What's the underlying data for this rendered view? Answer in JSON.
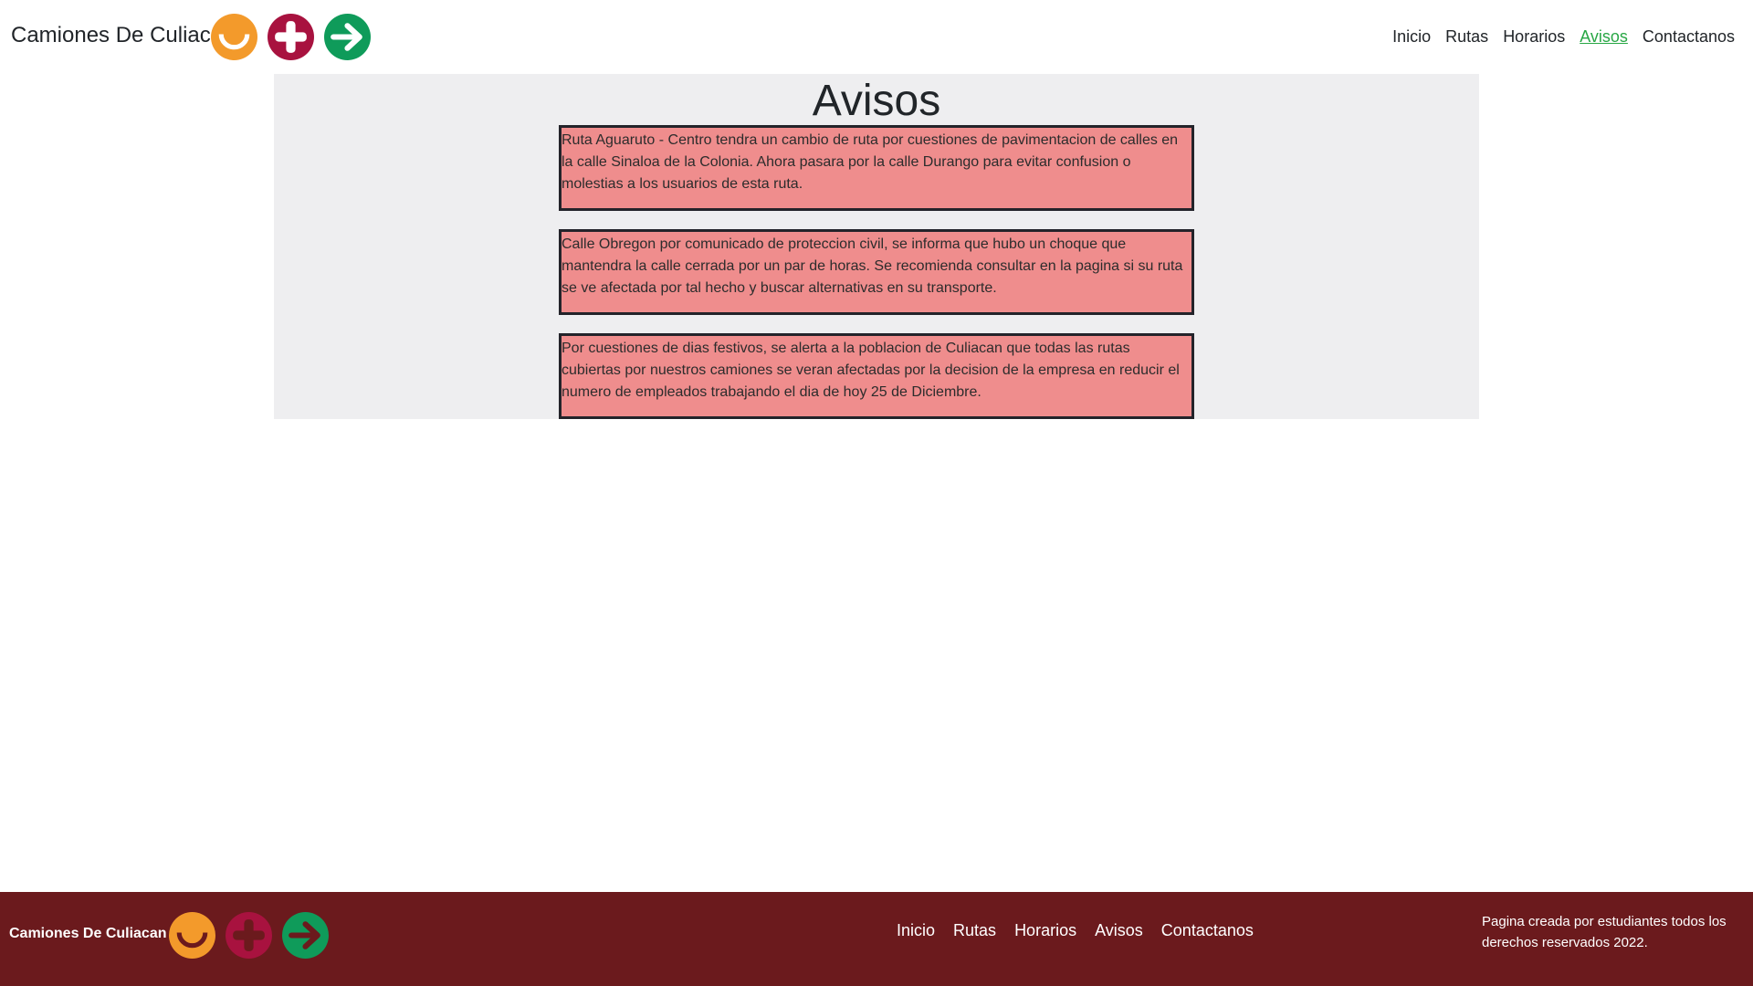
{
  "header": {
    "brand": "Camiones De Culiacan",
    "nav": [
      "Inicio",
      "Rutas",
      "Horarios",
      "Avisos",
      "Contactanos"
    ],
    "active_nav": "Avisos",
    "logo_icons": [
      "smile-icon",
      "plus-icon",
      "arrow-right-icon"
    ]
  },
  "main": {
    "title": "Avisos",
    "notices": [
      "Ruta Aguaruto - Centro tendra un cambio de ruta por cuestiones de pavimentacion de calles en la calle Sinaloa de la Colonia. Ahora pasara por la calle Durango para evitar confusion o molestias a los usuarios de esta ruta.",
      "Calle Obregon por comunicado de proteccion civil, se informa que hubo un choque que mantendra la calle cerrada por un par de horas. Se recomienda consultar en la pagina si su ruta se ve afectada por tal hecho y buscar alternativas en su transporte.",
      "Por cuestiones de dias festivos, se alerta a la poblacion de Culiacan que todas las rutas cubiertas por nuestros camiones se veran afectadas por la decision de la empresa en reducir el numero de empleados trabajando el dia de hoy 25 de Diciembre."
    ]
  },
  "footer": {
    "brand": "Camiones De Culiacan",
    "nav": [
      "Inicio",
      "Rutas",
      "Horarios",
      "Avisos",
      "Contactanos"
    ],
    "copyright": "Pagina creada por estudiantes todos los derechos reservados 2022."
  },
  "colors": {
    "orange": "#f39a2b",
    "crimson": "#a8123f",
    "green": "#0f9b5a",
    "footer_bg": "#6b1a1d",
    "notice_bg": "#ef8d8d",
    "active_link": "#28a745"
  }
}
